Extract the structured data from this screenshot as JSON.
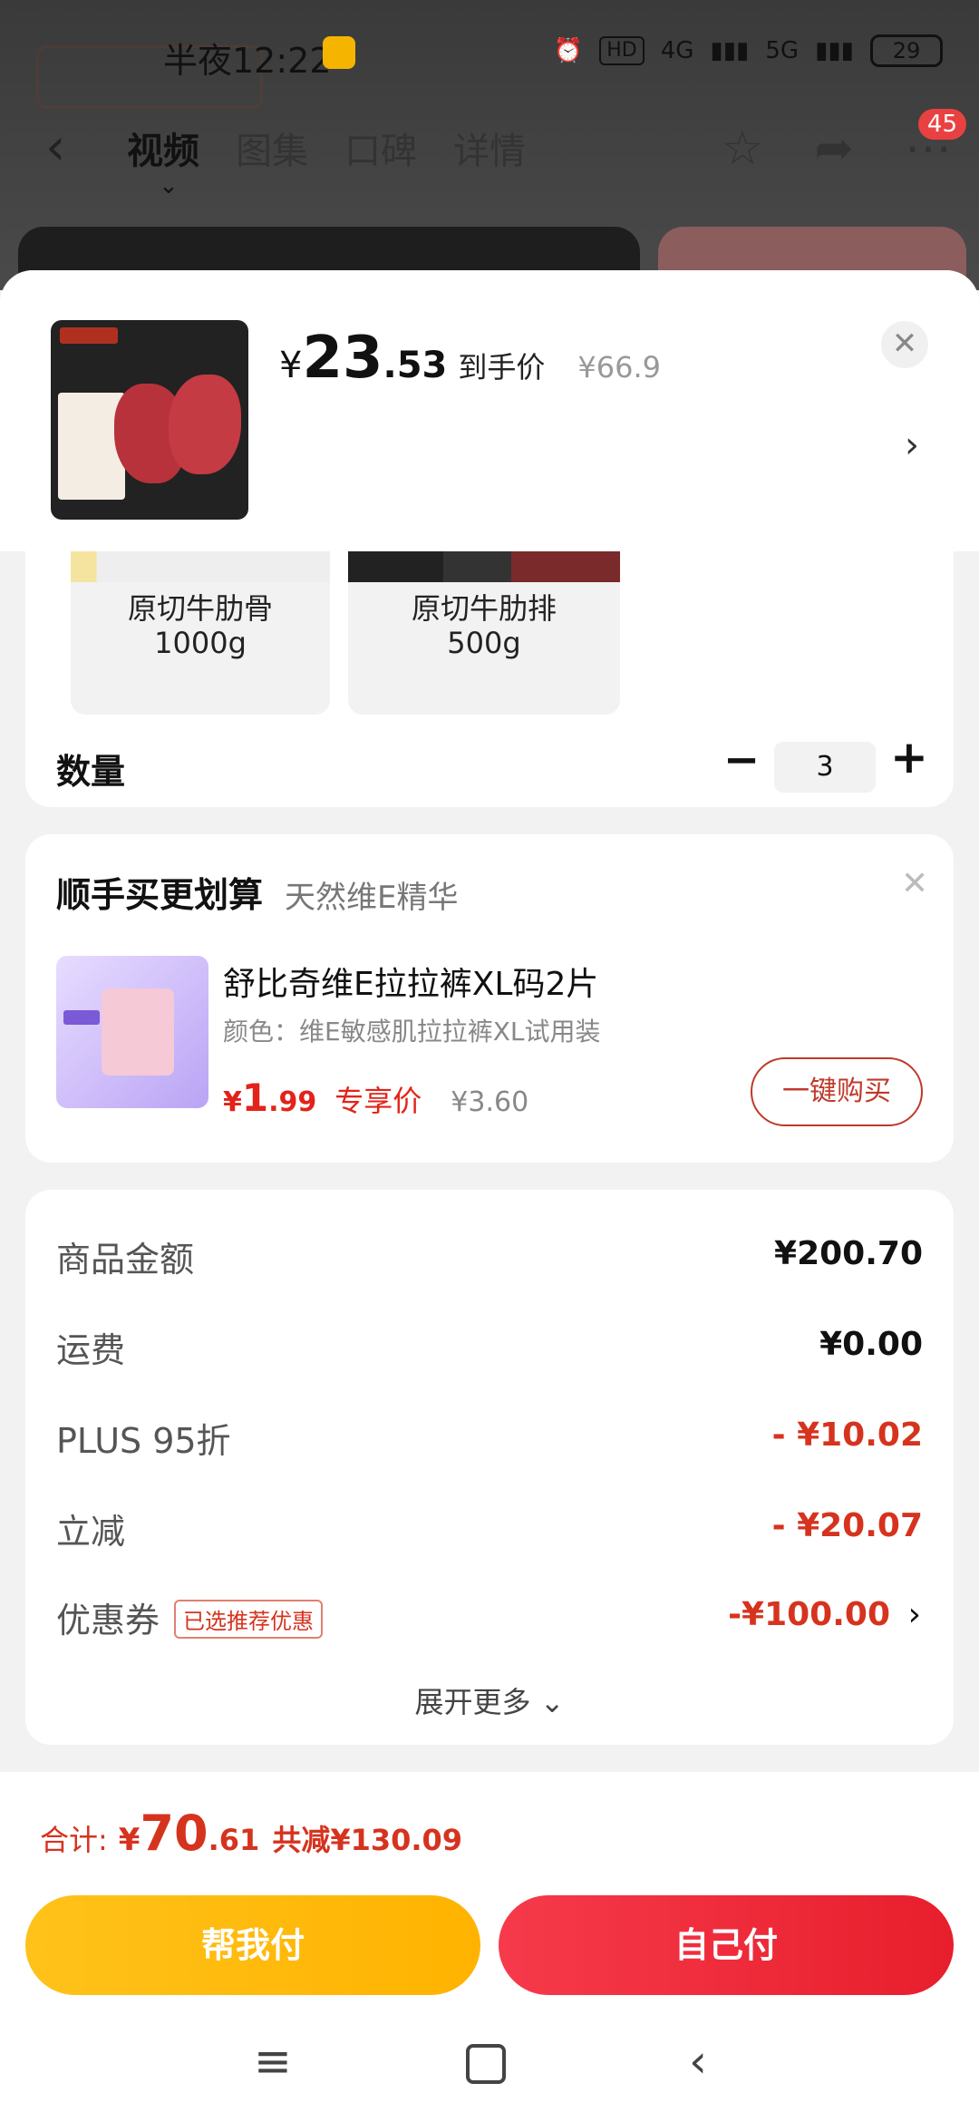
{
  "status_bar": {
    "time": "半夜12:22",
    "network": "HD",
    "sig1": "4G",
    "sig2": "5G",
    "battery": "29"
  },
  "bg_nav": {
    "tabs": [
      "视频",
      "图集",
      "口碑",
      "详情"
    ],
    "badge": "45"
  },
  "product": {
    "price_yen": "¥",
    "price_int": "23",
    "price_dec": ".53",
    "price_tag": "到手价",
    "price_orig": "¥66.9"
  },
  "variants": [
    {
      "name": "原切牛肋骨",
      "size": "1000g"
    },
    {
      "name": "原切牛肋排",
      "size": "500g"
    }
  ],
  "quantity": {
    "label": "数量",
    "value": "3"
  },
  "upsell": {
    "title": "顺手买更划算",
    "subtitle": "天然维E精华",
    "name": "舒比奇维E拉拉裤XL码2片",
    "spec": "颜色：维E敏感肌拉拉裤XL试用装",
    "price_yen": "¥",
    "price_int": "1",
    "price_dec": ".99",
    "price_tag": "专享价",
    "price_orig": "¥3.60",
    "buy_label": "一键购买"
  },
  "summary": {
    "rows": [
      {
        "label": "商品金额",
        "value": "¥200.70"
      },
      {
        "label": "运费",
        "value": "¥0.00"
      },
      {
        "label": "PLUS 95折",
        "value": "- ¥10.02"
      },
      {
        "label": "立减",
        "value": "- ¥20.07"
      },
      {
        "label": "优惠券",
        "value": "-¥100.00",
        "chip": "已选推荐优惠"
      }
    ],
    "expand": "展开更多"
  },
  "total": {
    "label": "合计:",
    "yen": "¥",
    "int": "70",
    "dec": ".61",
    "save": "共减¥130.09"
  },
  "buttons": {
    "help_pay": "帮我付",
    "self_pay": "自己付"
  },
  "colors": {
    "accent_red": "#d6331f",
    "yellow_btn": "#ffb300",
    "red_btn": "#e81e2c"
  }
}
